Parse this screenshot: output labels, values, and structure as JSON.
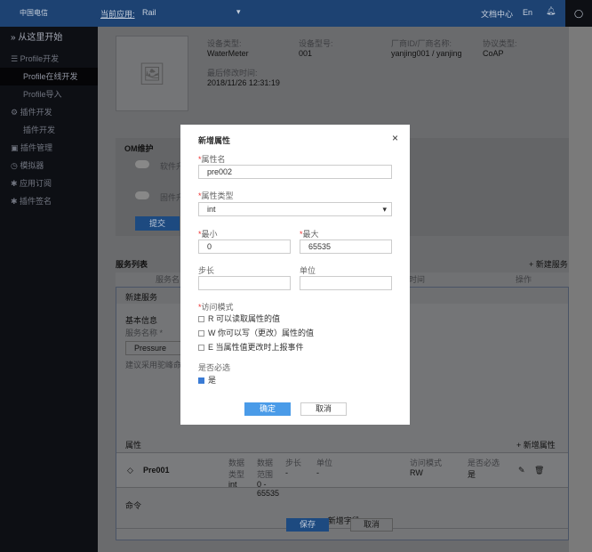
{
  "header": {
    "logo": "中国电信",
    "app_label": "当前应用:",
    "app_value": "Rail",
    "docs": "文档中心",
    "lang": "En"
  },
  "sidebar": {
    "items": [
      {
        "label": "从这里开始",
        "icon": "chevron-double-right-icon"
      },
      {
        "label": "Profile开发",
        "icon": "list-icon"
      },
      {
        "label": "Profile在线开发",
        "sub": true,
        "active": true
      },
      {
        "label": "Profile导入",
        "sub": true
      },
      {
        "label": "插件开发",
        "icon": "plugin-icon"
      },
      {
        "label": "插件开发",
        "sub": true
      },
      {
        "label": "插件管理",
        "icon": "box-icon"
      },
      {
        "label": "模拟器",
        "icon": "clock-icon"
      },
      {
        "label": "应用订阅",
        "icon": "gear-icon"
      },
      {
        "label": "插件签名",
        "icon": "gear-icon"
      }
    ]
  },
  "device": {
    "type_label": "设备类型:",
    "type": "WaterMeter",
    "model_label": "设备型号:",
    "model": "001",
    "vendor_label": "厂商ID/厂商名称:",
    "vendor": "yanjing001 / yanjing",
    "protocol_label": "协议类型:",
    "protocol": "CoAP",
    "modified_label": "最后修改时间:",
    "modified": "2018/11/26 12:31:19"
  },
  "om": {
    "title": "OM维护",
    "software": "软件升",
    "firmware": "固件升",
    "submit": "提交"
  },
  "services": {
    "title": "服务列表",
    "add": "新建服务",
    "col_name": "服务名",
    "col_time": "时间",
    "col_ops": "操作",
    "new_service": "新建服务",
    "basic_info": "基本信息",
    "service_name_label": "服务名称 *",
    "service_name": "Pressure",
    "hint": "建议采用驼峰命名",
    "props_title": "属性",
    "add_prop": "新增属性",
    "prop": {
      "name": "Pre001",
      "type_label": "数据类型",
      "type": "int",
      "range_label": "数据范围",
      "range": "0 - 65535",
      "step_label": "步长",
      "step": "-",
      "unit_label": "单位",
      "unit": "-",
      "access_label": "访问模式",
      "access": "RW",
      "required_label": "是否必选",
      "required": "是"
    },
    "cmd_title": "命令",
    "add_field": "新增字段",
    "save": "保存",
    "cancel": "取消"
  },
  "dialog": {
    "title": "新增属性",
    "name_label": "属性名",
    "name": "pre002",
    "type_label": "属性类型",
    "type": "int",
    "min_label": "最小",
    "min": "0",
    "max_label": "最大",
    "max": "65535",
    "step_label": "步长",
    "step": "",
    "unit_label": "单位",
    "unit": "",
    "access_label": "访问模式",
    "access": [
      {
        "label": "R  可以读取属性的值",
        "checked": false
      },
      {
        "label": "W  你可以写（更改）属性的值",
        "checked": false
      },
      {
        "label": "E  当属性值更改时上报事件",
        "checked": false
      }
    ],
    "required_label": "是否必选",
    "required": "是",
    "required_checked": true,
    "ok": "确定",
    "cancel": "取消"
  }
}
